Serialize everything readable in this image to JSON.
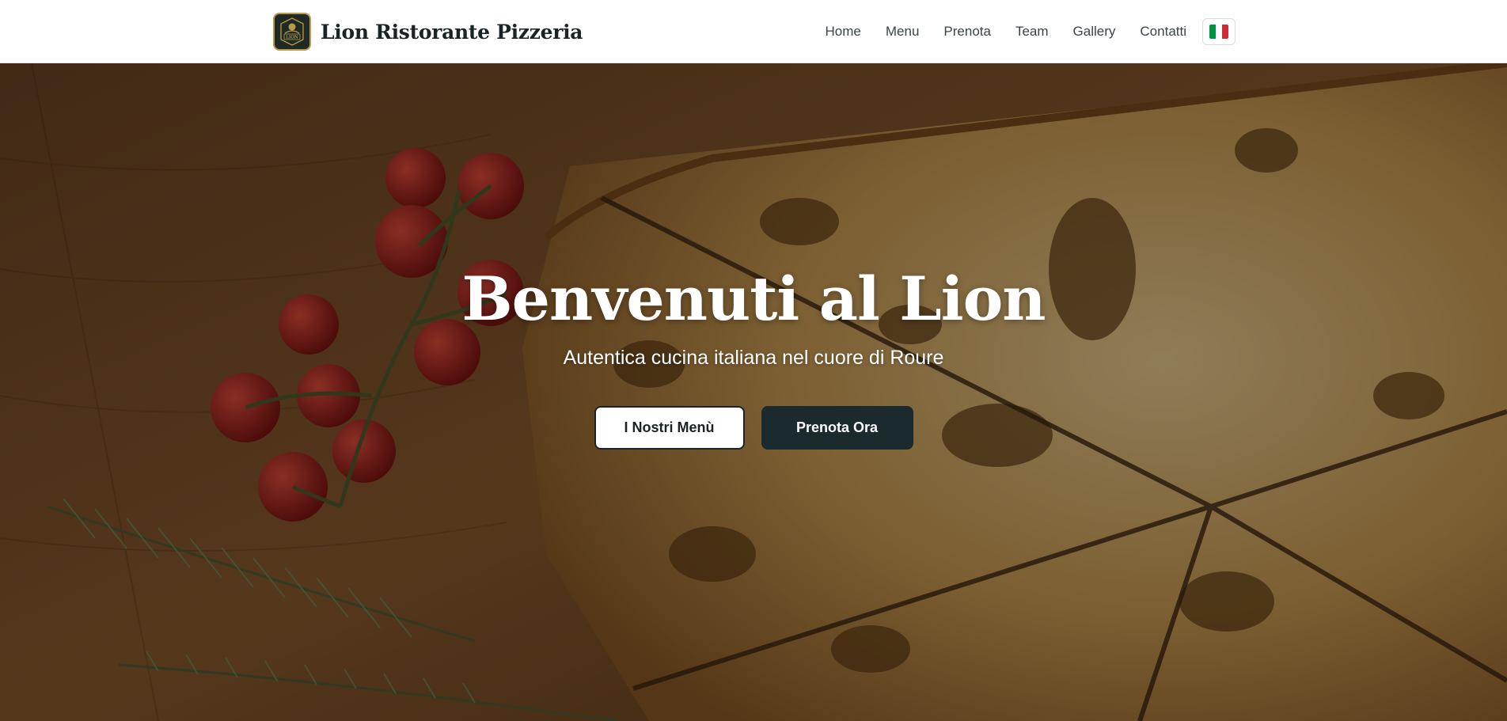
{
  "header": {
    "brand_name": "Lion Ristorante Pizzeria",
    "logo_text": "LION",
    "nav": [
      {
        "label": "Home"
      },
      {
        "label": "Menu"
      },
      {
        "label": "Prenota"
      },
      {
        "label": "Team"
      },
      {
        "label": "Gallery"
      },
      {
        "label": "Contatti"
      }
    ],
    "language_icon": "italian-flag-icon"
  },
  "hero": {
    "title": "Benvenuti al Lion",
    "subtitle": "Autentica cucina italiana nel cuore di Roure",
    "primary_button": "I Nostri Menù",
    "secondary_button": "Prenota Ora",
    "background_image": "pizza-on-wooden-board-with-tomatoes-and-rosemary"
  },
  "colors": {
    "dark": "#1a2a2d",
    "logo_gold": "#b89a4a",
    "flag_green": "#009246",
    "flag_white": "#ffffff",
    "flag_red": "#ce2b37"
  }
}
